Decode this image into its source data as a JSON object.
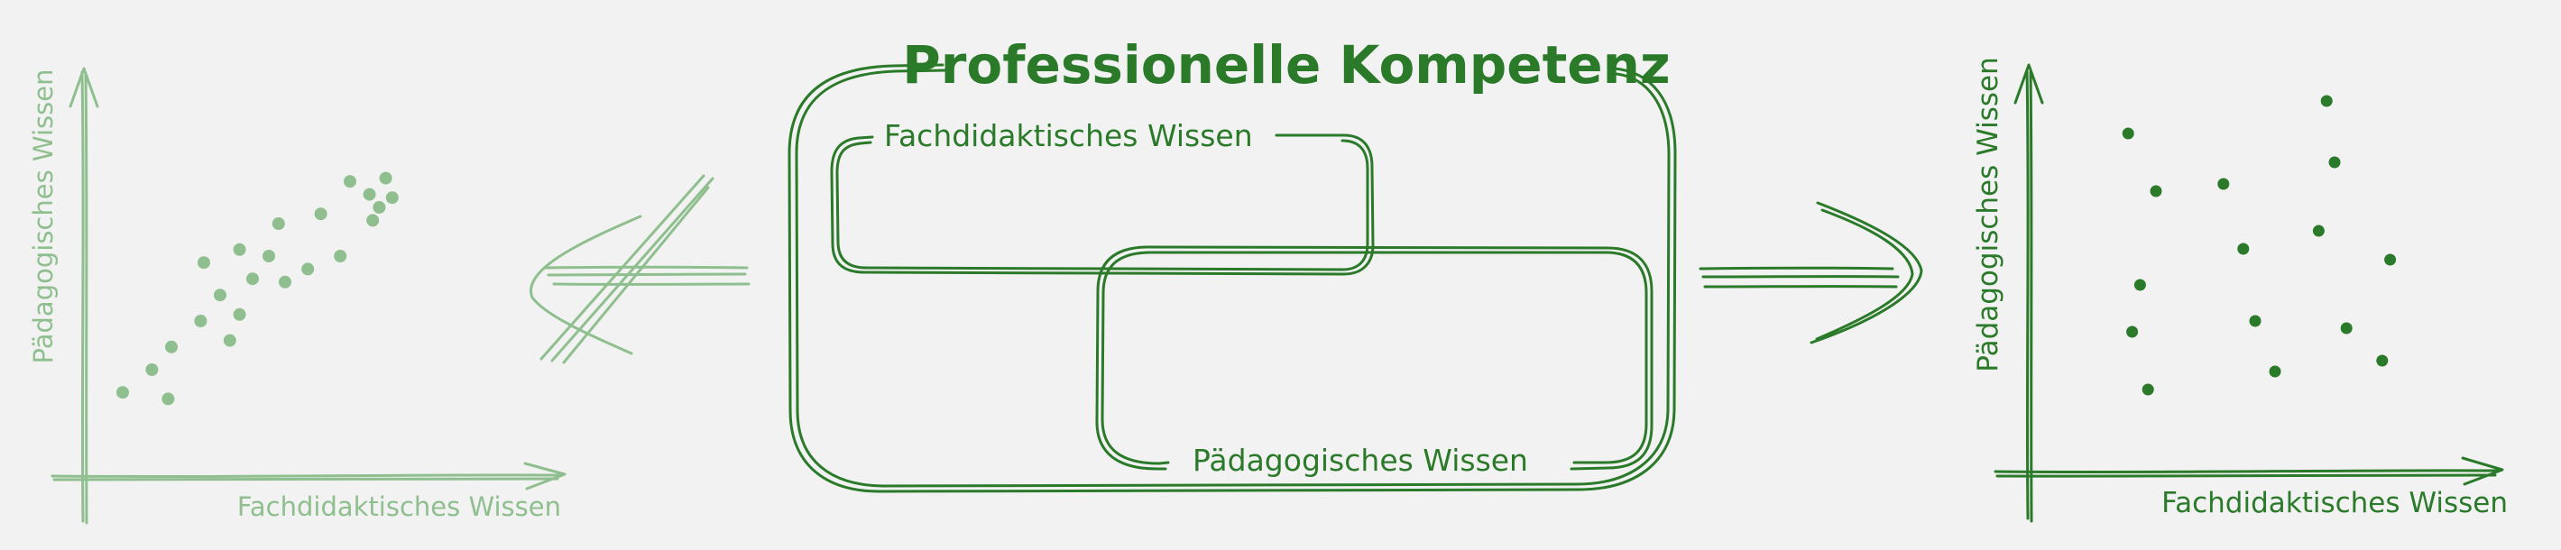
{
  "diagram": {
    "title": "Professionelle Kompetenz",
    "inner_boxes": {
      "fachdidaktik": "Fachdidaktisches Wissen",
      "paedagogik": "Pädagogisches Wissen"
    },
    "left_plot": {
      "x_label": "Fachdidaktisches Wissen",
      "y_label": "Pädagogisches Wissen",
      "points": [
        [
          0.1,
          0.18
        ],
        [
          0.19,
          0.25
        ],
        [
          0.24,
          0.16
        ],
        [
          0.25,
          0.32
        ],
        [
          0.34,
          0.4
        ],
        [
          0.4,
          0.48
        ],
        [
          0.35,
          0.58
        ],
        [
          0.43,
          0.34
        ],
        [
          0.46,
          0.42
        ],
        [
          0.5,
          0.53
        ],
        [
          0.46,
          0.62
        ],
        [
          0.55,
          0.6
        ],
        [
          0.58,
          0.7
        ],
        [
          0.6,
          0.52
        ],
        [
          0.67,
          0.56
        ],
        [
          0.71,
          0.73
        ],
        [
          0.77,
          0.6
        ],
        [
          0.8,
          0.83
        ],
        [
          0.86,
          0.79
        ],
        [
          0.87,
          0.71
        ],
        [
          0.89,
          0.75
        ],
        [
          0.91,
          0.84
        ],
        [
          0.93,
          0.78
        ]
      ]
    },
    "right_plot": {
      "x_label": "Fachdidaktisches Wissen",
      "y_label": "Pädagogisches Wissen",
      "points": [
        [
          0.18,
          0.88
        ],
        [
          0.25,
          0.72
        ],
        [
          0.21,
          0.46
        ],
        [
          0.19,
          0.33
        ],
        [
          0.23,
          0.17
        ],
        [
          0.42,
          0.74
        ],
        [
          0.47,
          0.56
        ],
        [
          0.5,
          0.36
        ],
        [
          0.55,
          0.22
        ],
        [
          0.66,
          0.61
        ],
        [
          0.68,
          0.97
        ],
        [
          0.7,
          0.8
        ],
        [
          0.73,
          0.34
        ],
        [
          0.84,
          0.53
        ],
        [
          0.82,
          0.25
        ]
      ]
    },
    "colors": {
      "primary": "#2a7a2a",
      "faded": "#8fbf8f",
      "background": "#f2f2f2"
    }
  }
}
